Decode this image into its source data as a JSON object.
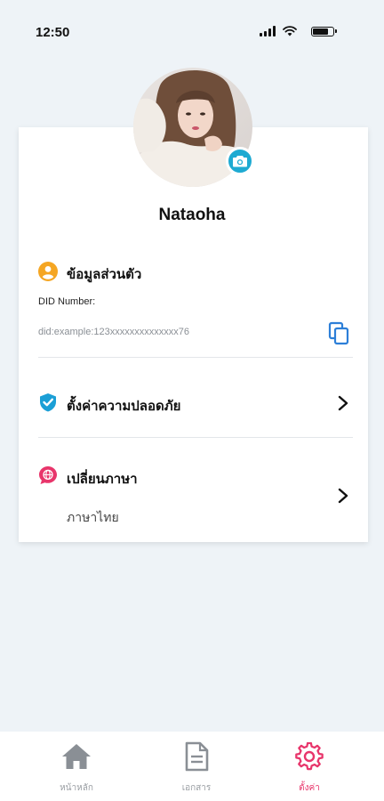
{
  "status_bar": {
    "time": "12:50"
  },
  "profile": {
    "name": "Nataoha"
  },
  "personal_info": {
    "title": "ข้อมูลส่วนตัว",
    "did_label": "DID Number:",
    "did_value": "did:example:123xxxxxxxxxxxxxx76"
  },
  "security": {
    "title": "ตั้งค่าความปลอดภัย"
  },
  "language": {
    "title": "เปลี่ยนภาษา",
    "current": "ภาษาไทย"
  },
  "bottom_nav": {
    "items": [
      {
        "label": "หน้าหลัก",
        "icon": "home-icon",
        "active": false
      },
      {
        "label": "เอกสาร",
        "icon": "document-icon",
        "active": false
      },
      {
        "label": "ตั้งค่า",
        "icon": "gear-icon",
        "active": true
      }
    ]
  },
  "colors": {
    "accent_pink": "#e8356b",
    "camera_blue": "#1eaad2",
    "profile_orange": "#f5a623",
    "shield_blue": "#1b9fd6",
    "copy_blue": "#2d7fd8"
  }
}
